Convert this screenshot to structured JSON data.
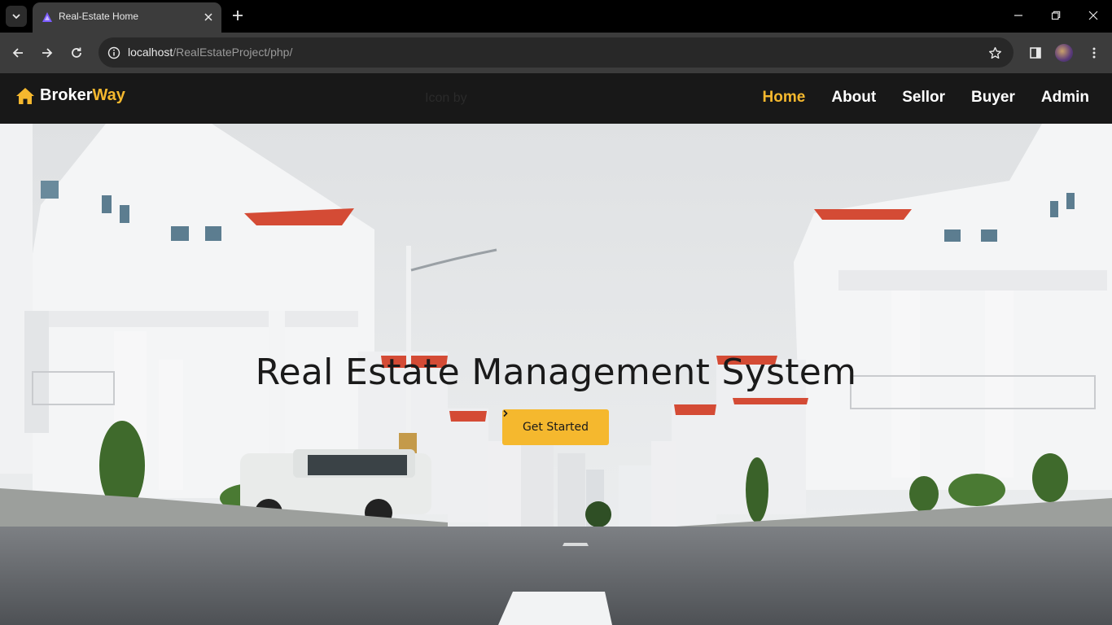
{
  "browser": {
    "tab_title": "Real-Estate Home",
    "url_host": "localhost",
    "url_path": "/RealEstateProject/php/"
  },
  "site": {
    "brand_part1": "Broker",
    "brand_part2": "Way",
    "credit_text": "Icon by",
    "nav": [
      {
        "label": "Home",
        "active": true
      },
      {
        "label": "About",
        "active": false
      },
      {
        "label": "Sellor",
        "active": false
      },
      {
        "label": "Buyer",
        "active": false
      },
      {
        "label": "Admin",
        "active": false
      }
    ]
  },
  "hero": {
    "title": "Real Estate Management System",
    "cta_label": "Get Started",
    "cta_icon": "chevron-right-icon"
  },
  "colors": {
    "accent": "#f5b82e",
    "navbar_bg": "#181818",
    "chrome_bg": "#3c3c3c"
  }
}
